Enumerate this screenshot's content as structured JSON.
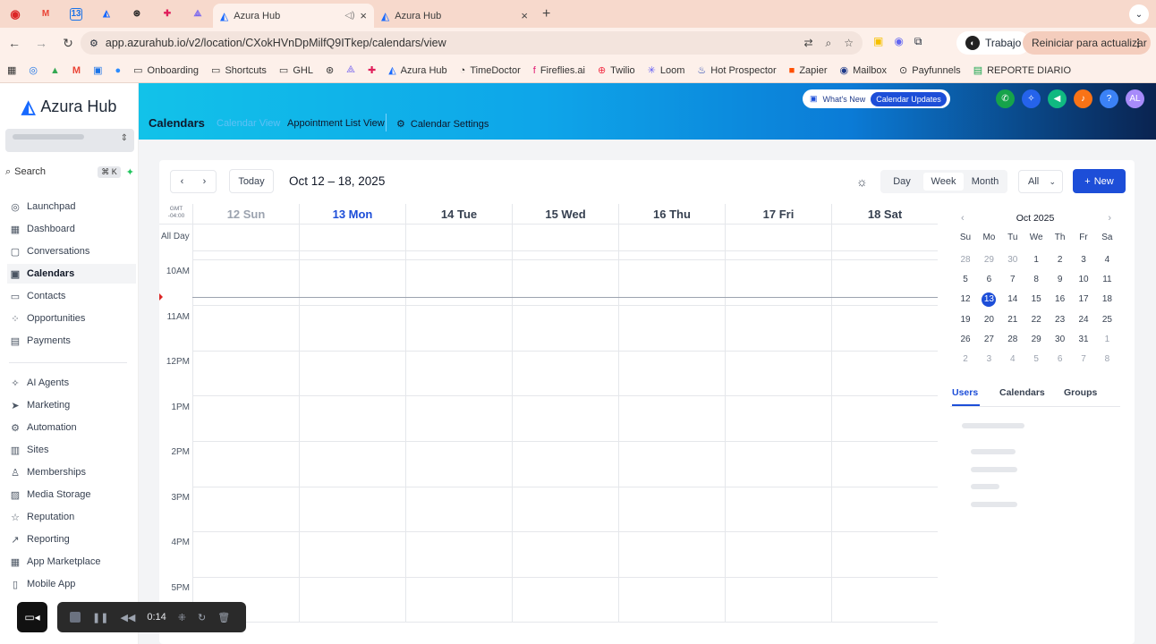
{
  "browser": {
    "tabs": [
      {
        "title": "Azura Hub",
        "active": true
      },
      {
        "title": "Azura Hub",
        "active": false
      }
    ],
    "url": "app.azurahub.io/v2/location/CXokHVnDpMilfQ9ITkep/calendars/view",
    "profile_label": "Trabajo",
    "update_label": "Reiniciar para actualizar",
    "bookmarks": [
      "Onboarding",
      "Shortcuts",
      "GHL",
      "Azura Hub",
      "TimeDoctor",
      "Fireflies.ai",
      "Twilio",
      "Loom",
      "Hot Prospector",
      "Zapier",
      "Mailbox",
      "Payfunnels",
      "REPORTE DIARIO"
    ]
  },
  "sidebar": {
    "logo": "Azura Hub",
    "search_label": "Search",
    "search_kbd": "⌘ K",
    "items": [
      {
        "label": "Launchpad",
        "icon": "launchpad-icon"
      },
      {
        "label": "Dashboard",
        "icon": "dashboard-icon"
      },
      {
        "label": "Conversations",
        "icon": "chat-icon"
      },
      {
        "label": "Calendars",
        "icon": "calendar-icon",
        "selected": true
      },
      {
        "label": "Contacts",
        "icon": "contacts-icon"
      },
      {
        "label": "Opportunities",
        "icon": "opportunities-icon"
      },
      {
        "label": "Payments",
        "icon": "payments-icon"
      },
      {
        "label": "AI Agents",
        "icon": "ai-agents-icon"
      },
      {
        "label": "Marketing",
        "icon": "marketing-icon"
      },
      {
        "label": "Automation",
        "icon": "automation-icon"
      },
      {
        "label": "Sites",
        "icon": "sites-icon"
      },
      {
        "label": "Memberships",
        "icon": "memberships-icon"
      },
      {
        "label": "Media Storage",
        "icon": "media-storage-icon"
      },
      {
        "label": "Reputation",
        "icon": "star-icon"
      },
      {
        "label": "Reporting",
        "icon": "reporting-icon"
      },
      {
        "label": "App Marketplace",
        "icon": "marketplace-icon"
      },
      {
        "label": "Mobile App",
        "icon": "mobile-icon"
      }
    ]
  },
  "header": {
    "title": "Calendars",
    "tabs": [
      "Calendar View",
      "Appointment List View",
      "Calendar Settings"
    ],
    "whats_new": "What's New",
    "calendar_updates": "Calendar Updates",
    "avatar": "AL"
  },
  "toolbar": {
    "today": "Today",
    "date_range": "Oct 12 – 18, 2025",
    "views": [
      "Day",
      "Week",
      "Month"
    ],
    "selected_view": "Week",
    "filter": "All",
    "new_label": "New"
  },
  "grid": {
    "timezone": [
      "GMT",
      "-04:00"
    ],
    "all_day": "All Day",
    "days": [
      {
        "label": "12 Sun",
        "state": "past"
      },
      {
        "label": "13 Mon",
        "state": "today"
      },
      {
        "label": "14 Tue",
        "state": "future"
      },
      {
        "label": "15 Wed",
        "state": "future"
      },
      {
        "label": "16 Thu",
        "state": "future"
      },
      {
        "label": "17 Fri",
        "state": "future"
      },
      {
        "label": "18 Sat",
        "state": "future"
      }
    ],
    "hours": [
      "10AM",
      "11AM",
      "12PM",
      "1PM",
      "2PM",
      "3PM",
      "4PM",
      "5PM"
    ]
  },
  "mini_calendar": {
    "title": "Oct 2025",
    "dow": [
      "Su",
      "Mo",
      "Tu",
      "We",
      "Th",
      "Fr",
      "Sa"
    ],
    "weeks": [
      [
        "28",
        "29",
        "30",
        "1",
        "2",
        "3",
        "4"
      ],
      [
        "5",
        "6",
        "7",
        "8",
        "9",
        "10",
        "11"
      ],
      [
        "12",
        "13",
        "14",
        "15",
        "16",
        "17",
        "18"
      ],
      [
        "19",
        "20",
        "21",
        "22",
        "23",
        "24",
        "25"
      ],
      [
        "26",
        "27",
        "28",
        "29",
        "30",
        "31",
        "1"
      ],
      [
        "2",
        "3",
        "4",
        "5",
        "6",
        "7",
        "8"
      ]
    ],
    "selected": "13"
  },
  "user_tabs": [
    "Users",
    "Calendars",
    "Groups"
  ],
  "recorder": {
    "time": "0:14"
  },
  "colors": {
    "accent": "#1d4ed8",
    "now_marker": "#dc2626"
  }
}
